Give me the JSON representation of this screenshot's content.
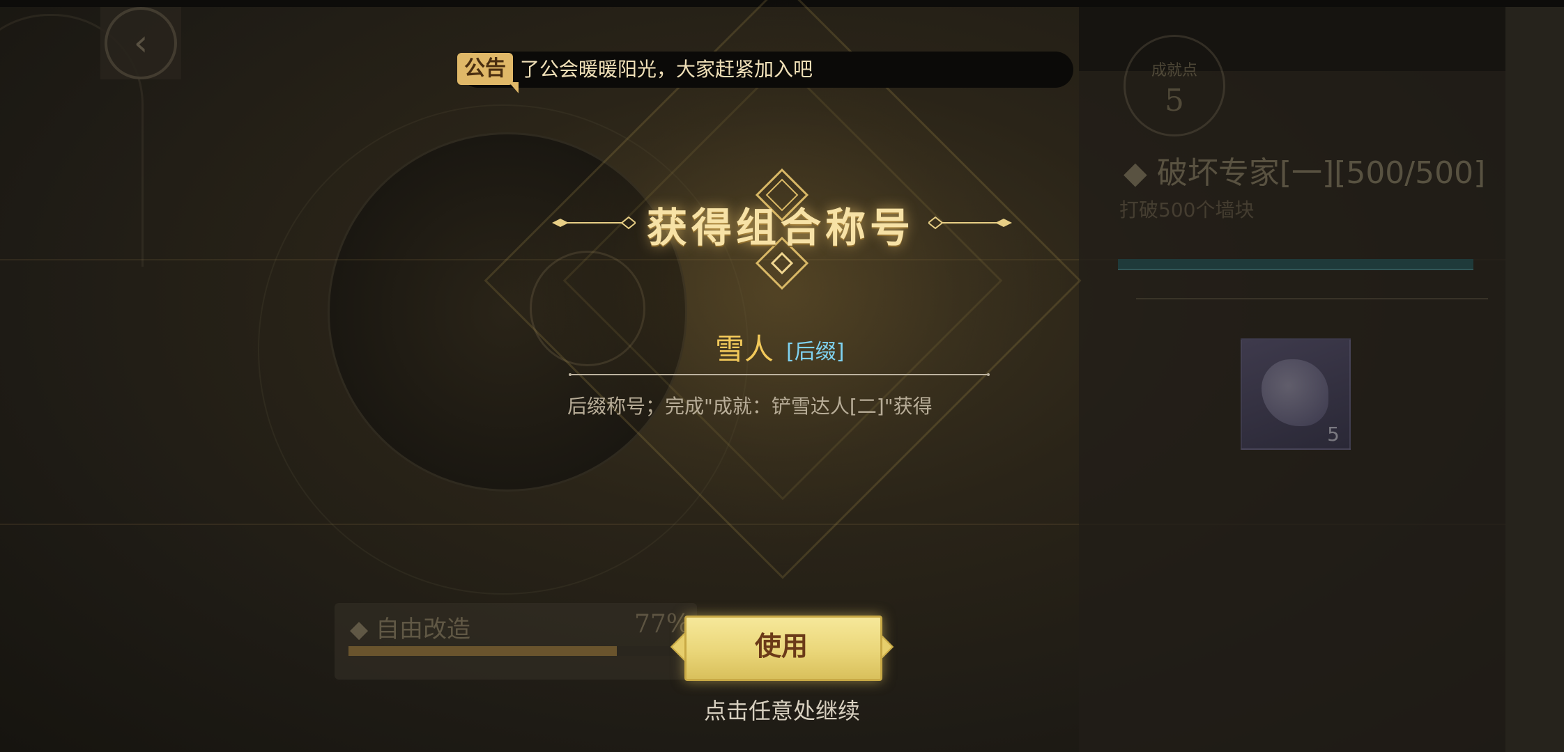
{
  "announcement": {
    "tag": "公告",
    "text": "了公会暖暖阳光，大家赶紧加入吧"
  },
  "background": {
    "points_label": "成就点",
    "points_value": "5",
    "achievement_title": "◆ 破坏专家[一][500/500]",
    "achievement_desc": "打破500个墙块",
    "achievement_progress": 1.0,
    "reward_count": "5",
    "free_mod_title": "◆ 自由改造",
    "free_mod_percent": "77%",
    "free_mod_progress": 0.77
  },
  "modal": {
    "heading": "获得组合称号",
    "title_name": "雪人",
    "title_tag": "[后缀]",
    "description": "后缀称号；完成\"成就：铲雪达人[二]\"获得",
    "use_button": "使用",
    "continue_hint": "点击任意处继续"
  },
  "colors": {
    "accent_gold": "#f2c95a",
    "tag_blue": "#7fd2f0",
    "button_gold": "#ead679"
  }
}
